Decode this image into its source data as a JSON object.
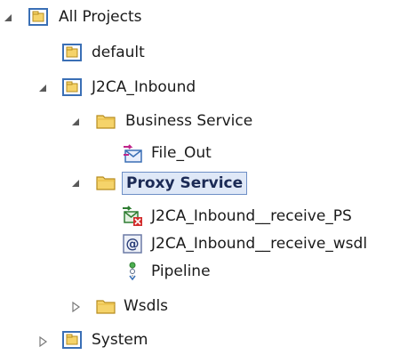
{
  "tree": {
    "all_projects": "All Projects",
    "default": "default",
    "j2ca_inbound": "J2CA_Inbound",
    "business_service": "Business Service",
    "file_out": "File_Out",
    "proxy_service": "Proxy Service",
    "receive_ps": "J2CA_Inbound__receive_PS",
    "receive_wsdl": "J2CA_Inbound__receive_wsdl",
    "pipeline": "Pipeline",
    "wsdls": "Wsdls",
    "system": "System"
  },
  "colors": {
    "selection_bg": "#dfe8f7",
    "selection_border": "#6e8fc6",
    "folder_yellow": "#f5d36a",
    "project_blue": "#3a6fb5"
  }
}
